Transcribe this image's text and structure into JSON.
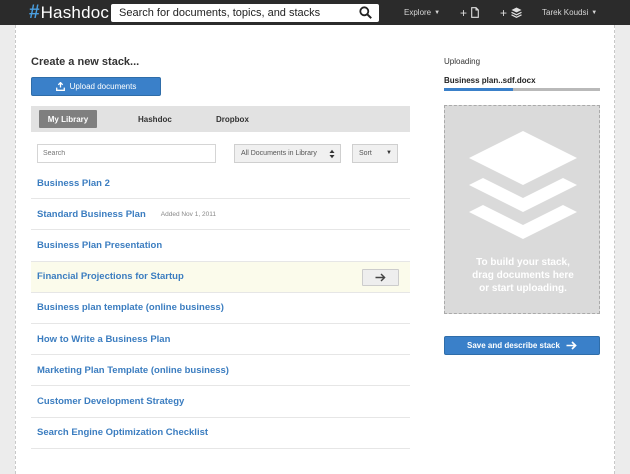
{
  "header": {
    "logo_hash": "#",
    "logo_text": "Hashdoc",
    "search_placeholder": "Search for documents, topics, and stacks",
    "explore_label": "Explore",
    "add_doc_label": "+",
    "add_stack_label": "+",
    "user_name": "Tarek Koudsi",
    "caret": "▼"
  },
  "main": {
    "title": "Create a new stack...",
    "upload_label": "Upload documents",
    "tabs": [
      {
        "label": "My Library",
        "active": true
      },
      {
        "label": "Hashdoc",
        "active": false
      },
      {
        "label": "Dropbox",
        "active": false
      }
    ],
    "filter_placeholder": "Search",
    "library_select": "All Documents in Library",
    "sort_select": "Sort",
    "documents": [
      {
        "title": "Business Plan 2",
        "meta": ""
      },
      {
        "title": "Standard Business Plan",
        "meta": "Added Nov 1, 2011"
      },
      {
        "title": "Business Plan Presentation",
        "meta": ""
      },
      {
        "title": "Financial Projections for Startup",
        "meta": "",
        "highlight": true
      },
      {
        "title": "Business plan template (online business)",
        "meta": ""
      },
      {
        "title": "How to Write a Business Plan",
        "meta": ""
      },
      {
        "title": "Marketing Plan Template (online business)",
        "meta": ""
      },
      {
        "title": "Customer Development Strategy",
        "meta": ""
      },
      {
        "title": "Search Engine Optimization Checklist",
        "meta": ""
      }
    ]
  },
  "sidebar": {
    "uploading_label": "Uploading",
    "file_name": "Business plan..sdf.docx",
    "progress": 0.44,
    "drop_text": [
      "To build your stack,",
      "drag documents here",
      "or start uploading."
    ],
    "save_label": "Save and describe stack"
  },
  "colors": {
    "accent": "#3a80c9",
    "link": "#3b7dc0",
    "topbar": "#2b2b2b"
  },
  "icons": [
    "search-icon",
    "caret-down-icon",
    "plus-icon",
    "document-icon",
    "stack-icon",
    "upload-icon",
    "arrow-right-icon",
    "updown-icon"
  ]
}
